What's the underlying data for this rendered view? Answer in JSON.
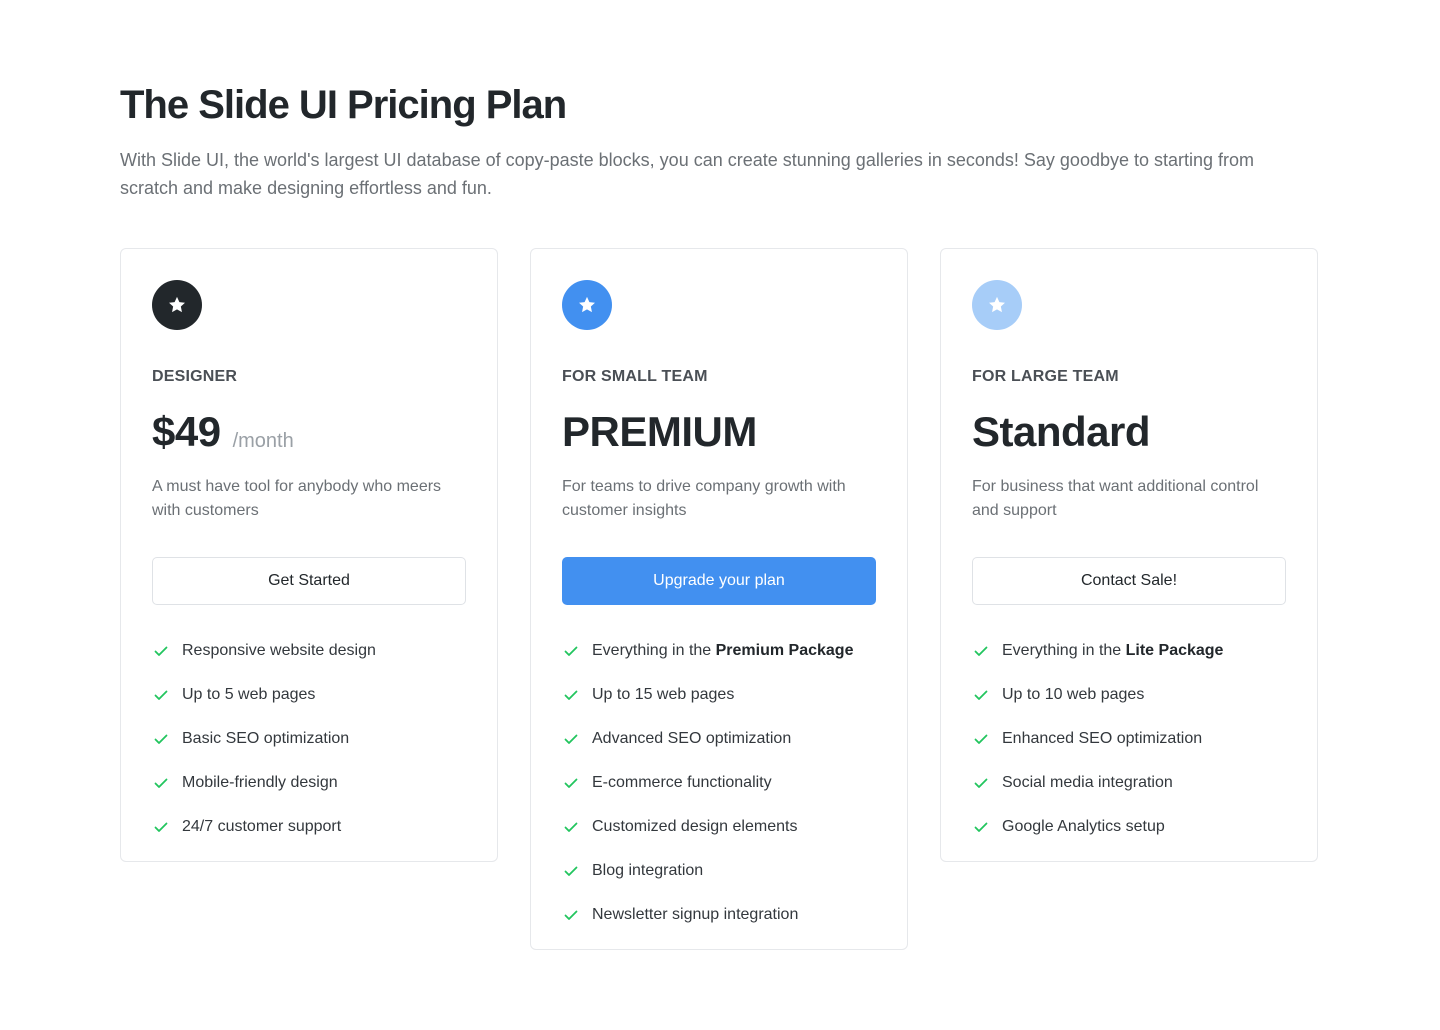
{
  "header": {
    "title": "The Slide UI Pricing Plan",
    "description": "With Slide UI, the world's largest UI database of copy-paste blocks, you can create stunning galleries in seconds! Say goodbye to starting from scratch and make designing effortless and fun."
  },
  "colors": {
    "accent": "#4290f0",
    "check": "#22c55e",
    "badge_dark": "#22272b",
    "badge_blue": "#4290f0",
    "badge_light": "#a7cdf8"
  },
  "plans": [
    {
      "icon": "star-icon",
      "tier": "DESIGNER",
      "headline": "$49",
      "period": "/month",
      "description": "A must have tool for anybody who meers with customers",
      "cta": "Get Started",
      "features": [
        {
          "prefix": "Responsive website design",
          "bold": ""
        },
        {
          "prefix": "Up to 5 web pages",
          "bold": ""
        },
        {
          "prefix": "Basic SEO optimization",
          "bold": ""
        },
        {
          "prefix": "Mobile-friendly design",
          "bold": ""
        },
        {
          "prefix": "24/7 customer support",
          "bold": ""
        }
      ]
    },
    {
      "icon": "star-icon",
      "tier": "FOR SMALL TEAM",
      "headline": "PREMIUM",
      "period": "",
      "description": "For teams to drive company growth with customer insights",
      "cta": "Upgrade your plan",
      "features": [
        {
          "prefix": "Everything in the ",
          "bold": "Premium Package"
        },
        {
          "prefix": "Up to 15 web pages",
          "bold": ""
        },
        {
          "prefix": "Advanced SEO optimization",
          "bold": ""
        },
        {
          "prefix": "E-commerce functionality",
          "bold": ""
        },
        {
          "prefix": "Customized design elements",
          "bold": ""
        },
        {
          "prefix": "Blog integration",
          "bold": ""
        },
        {
          "prefix": "Newsletter signup integration",
          "bold": ""
        }
      ]
    },
    {
      "icon": "star-icon",
      "tier": "FOR LARGE TEAM",
      "headline": "Standard",
      "period": "",
      "description": "For business that want additional control and support",
      "cta": "Contact Sale!",
      "features": [
        {
          "prefix": "Everything in the ",
          "bold": "Lite Package"
        },
        {
          "prefix": "Up to 10 web pages",
          "bold": ""
        },
        {
          "prefix": "Enhanced SEO optimization",
          "bold": ""
        },
        {
          "prefix": "Social media integration",
          "bold": ""
        },
        {
          "prefix": "Google Analytics setup",
          "bold": ""
        }
      ]
    }
  ]
}
